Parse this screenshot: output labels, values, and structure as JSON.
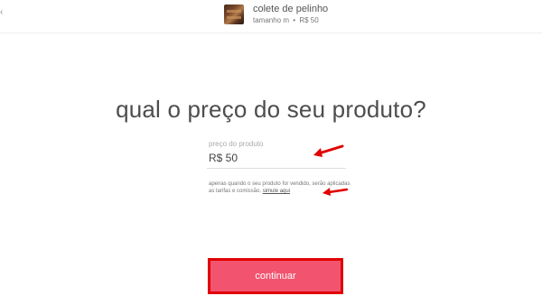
{
  "header": {
    "back_glyph": "‹",
    "product_title": "colete de pelinho",
    "product_size": "tamanho m",
    "product_separator": "•",
    "product_price": "R$ 50",
    "thumbnail_icon": "product-photo-thumbnail"
  },
  "main": {
    "question": "qual o preço do seu produto?",
    "price_field": {
      "label": "preço do produto",
      "value": "R$ 50"
    },
    "note_text": "apenas quando o seu produto for vendido, serão aplicadas as tarifas e comissão. ",
    "note_link": "simule aqui",
    "continue_label": "continuar"
  },
  "annotations": {
    "arrow_color": "#e00000",
    "highlight_color": "#e00000"
  },
  "colors": {
    "accent": "#f2546f"
  }
}
